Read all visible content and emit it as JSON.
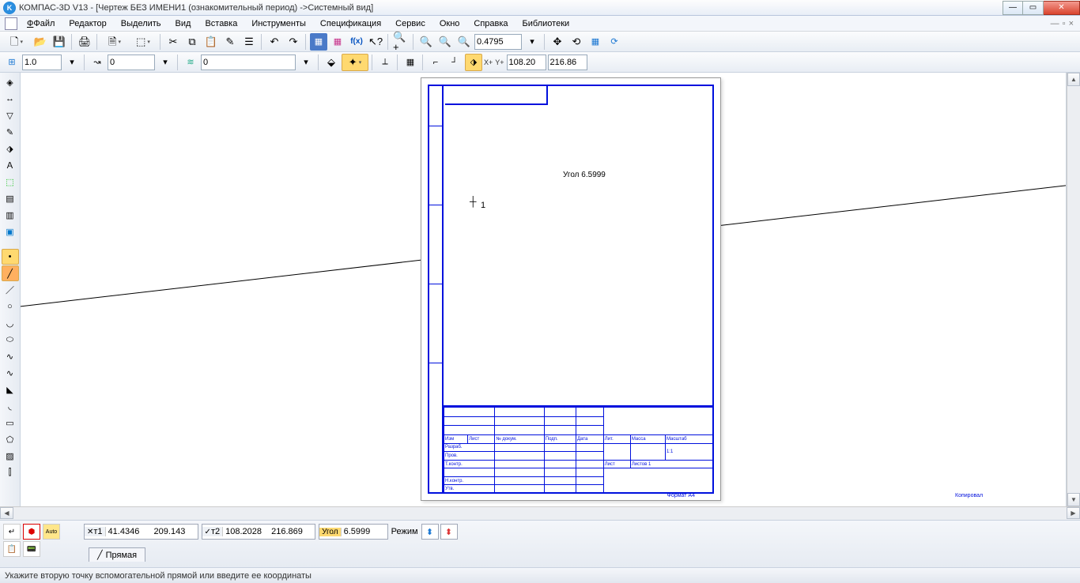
{
  "title": "КОМПАС-3D V13 - [Чертеж БЕЗ ИМЕНИ1 (ознакомительный период) ->Системный вид]",
  "menu": {
    "file": "Файл",
    "edit": "Редактор",
    "select": "Выделить",
    "view": "Вид",
    "insert": "Вставка",
    "tools": "Инструменты",
    "spec": "Спецификация",
    "service": "Сервис",
    "window": "Окно",
    "help": "Справка",
    "libs": "Библиотеки"
  },
  "toolbar2": {
    "step": "1.0",
    "style": "0",
    "layer": "0",
    "zoom": "0.4795",
    "xlabel": "X+",
    "ylabel": "Y+",
    "xval": "108.20",
    "yval": "216.86"
  },
  "canvas": {
    "angle_label": "Угол 6.5999",
    "cursor": "1",
    "copy": "Копировал",
    "format": "Формат   A4"
  },
  "stamp": {
    "scale": "1:1",
    "r1": "Изм",
    "r2": "Лист",
    "r3": "№ докум.",
    "r4": "Подп.",
    "r5": "Дата",
    "p1": "Разраб.",
    "p2": "Пров.",
    "p3": "Т.контр.",
    "p4": "Н.контр.",
    "p5": "Утв.",
    "lit": "Лит.",
    "mass": "Масса",
    "msht": "Масштаб",
    "list": "Лист",
    "lists": "Листов   1"
  },
  "prop": {
    "t1_label": "т1",
    "t1x": "41.4346",
    "t1y": "209.143",
    "t2_label": "т2",
    "t2x": "108.2028",
    "t2y": "216.869",
    "angle_label": "Угол",
    "angle": "6.5999",
    "mode_label": "Режим",
    "tab": "Прямая"
  },
  "status": "Укажите вторую точку вспомогательной прямой или введите ее координаты"
}
